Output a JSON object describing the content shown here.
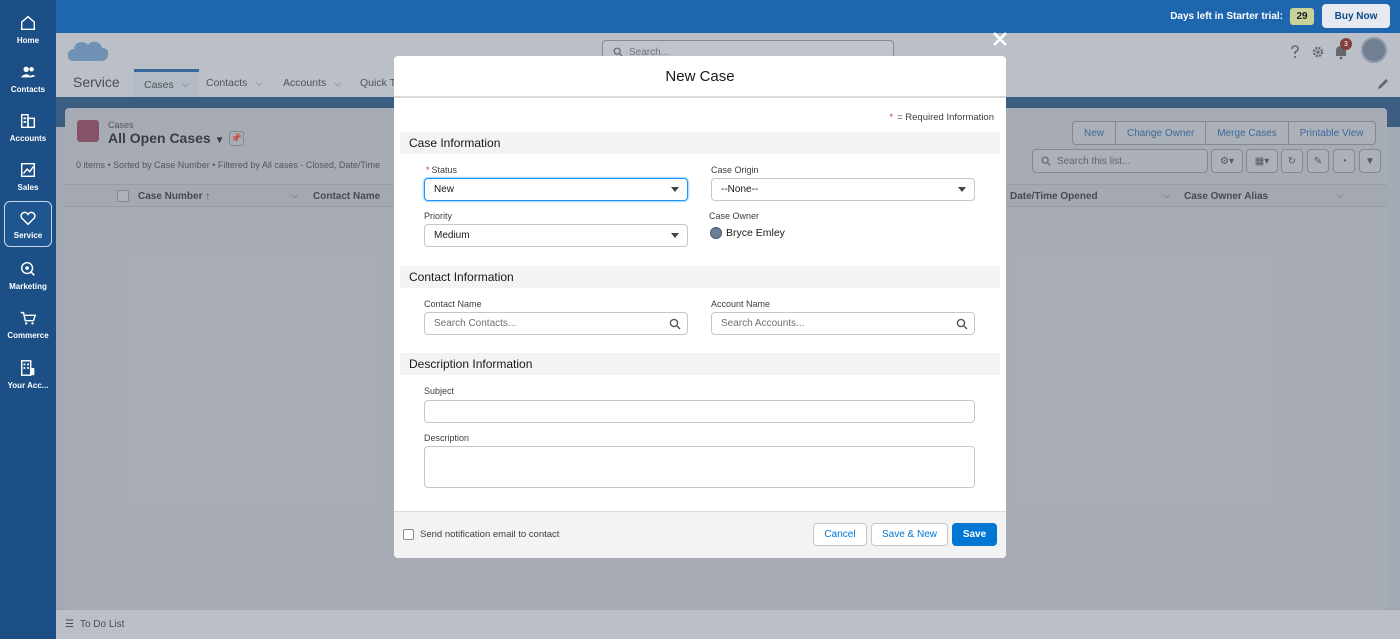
{
  "rail": {
    "items": [
      {
        "label": "Home",
        "icon": "home-icon"
      },
      {
        "label": "Contacts",
        "icon": "contacts-icon"
      },
      {
        "label": "Accounts",
        "icon": "accounts-icon"
      },
      {
        "label": "Sales",
        "icon": "sales-icon"
      },
      {
        "label": "Service",
        "icon": "heart-icon",
        "active": true
      },
      {
        "label": "Marketing",
        "icon": "marketing-icon"
      },
      {
        "label": "Commerce",
        "icon": "cart-icon"
      },
      {
        "label": "Your Acc...",
        "icon": "building-icon"
      }
    ]
  },
  "trial": {
    "text": "Days left in Starter trial:",
    "days": "29",
    "buy_label": "Buy Now"
  },
  "header": {
    "search_placeholder": "Search...",
    "notification_count": "3",
    "app_name": "Service",
    "tabs": [
      {
        "label": "Cases"
      },
      {
        "label": "Contacts"
      },
      {
        "label": "Accounts"
      },
      {
        "label": "Quick T"
      }
    ]
  },
  "listview": {
    "object_label": "Cases",
    "view_name": "All Open Cases",
    "meta": "0 items • Sorted by Case Number • Filtered by All cases - Closed, Date/Time",
    "buttons": [
      "New",
      "Change Owner",
      "Merge Cases",
      "Printable View"
    ],
    "search_placeholder": "Search this list...",
    "columns": [
      "Case Number ↑",
      "Contact Name",
      "Date/Time Opened",
      "Case Owner Alias"
    ]
  },
  "footer": {
    "todo_label": "To Do List"
  },
  "modal": {
    "title": "New Case",
    "required_note": "= Required Information",
    "required_star": "*",
    "sections": {
      "case_info": "Case Information",
      "contact_info": "Contact Information",
      "description_info": "Description Information"
    },
    "fields": {
      "status_label": "Status",
      "status_value": "New",
      "origin_label": "Case Origin",
      "origin_value": "--None--",
      "priority_label": "Priority",
      "priority_value": "Medium",
      "owner_label": "Case Owner",
      "owner_value": "Bryce Emley",
      "contact_label": "Contact Name",
      "contact_placeholder": "Search Contacts...",
      "account_label": "Account Name",
      "account_placeholder": "Search Accounts...",
      "subject_label": "Subject",
      "description_label": "Description"
    },
    "footer": {
      "notify_label": "Send notification email to contact",
      "cancel": "Cancel",
      "save_new": "Save & New",
      "save": "Save"
    }
  },
  "colors": {
    "brand_blue": "#0176d3",
    "rail_bg": "#1b4f86",
    "required_red": "#c23934"
  }
}
